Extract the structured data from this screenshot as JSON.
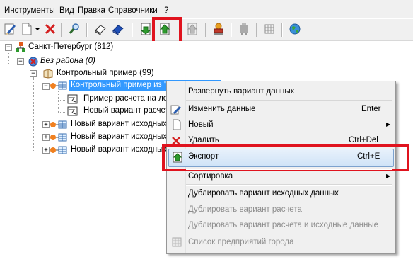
{
  "menubar": {
    "items": [
      "Инструменты",
      "Вид",
      "Правка",
      "Справочники",
      "?"
    ]
  },
  "toolbar": {
    "buttons": [
      "edit-pencil-icon",
      "new-document-icon",
      "dropdown-arrow-icon",
      "delete-x-icon",
      "find-icon",
      "eraser-icon",
      "eraser-blue-icon",
      "import-icon",
      "export-icon",
      "export-gray-icon",
      "stamp-icon",
      "tool-gray-icon",
      "grid-icon",
      "globe-icon"
    ]
  },
  "tree": {
    "root": "Санкт-Петербург (812)",
    "district": "Без района (0)",
    "example": "Контрольный пример (99)",
    "selected": "Контрольный пример из \"Э...        \"",
    "child1": "Пример расчета на лет",
    "child2": "Новый вариант расчет",
    "sib1": "Новый вариант исходных д",
    "sib2": "Новый вариант исходных д",
    "sib3": "Новый вариант исходных д"
  },
  "context_menu": {
    "expand": "Развернуть вариант данных",
    "edit": "Изменить данные",
    "edit_shortcut": "Enter",
    "new": "Новый",
    "delete": "Удалить",
    "delete_shortcut": "Ctrl+Del",
    "export": "Экспорт",
    "export_shortcut": "Ctrl+E",
    "sort": "Сортировка",
    "dup_source": "Дублировать вариант исходных данных",
    "dup_calc": "Дублировать вариант расчета",
    "dup_calc_source": "Дублировать вариант расчета и исходные данные",
    "city_list": "Список предприятий города"
  },
  "colors": {
    "selection": "#3399ff",
    "highlight": "#e0131e"
  }
}
